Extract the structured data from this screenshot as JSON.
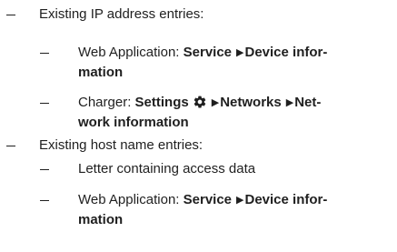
{
  "list": {
    "ip": {
      "heading": "Existing IP address entries:",
      "web": {
        "prefix": "Web Application: ",
        "service": "Service",
        "arrow": "▶",
        "device_line1": "Device infor-",
        "device_line2": "mation"
      },
      "charger": {
        "prefix": "Charger: ",
        "settings": "Settings",
        "gear_icon": "gear-icon",
        "arrow1": "▶",
        "networks": "Networks",
        "arrow2": "▶",
        "net_line1": "Net-",
        "net_line2": "work information"
      }
    },
    "host": {
      "heading": "Existing host name entries:",
      "letter": "Letter containing access data",
      "web": {
        "prefix": "Web Application: ",
        "service": "Service",
        "arrow": "▶",
        "device_line1": "Device infor-",
        "device_line2": "mation"
      }
    }
  }
}
